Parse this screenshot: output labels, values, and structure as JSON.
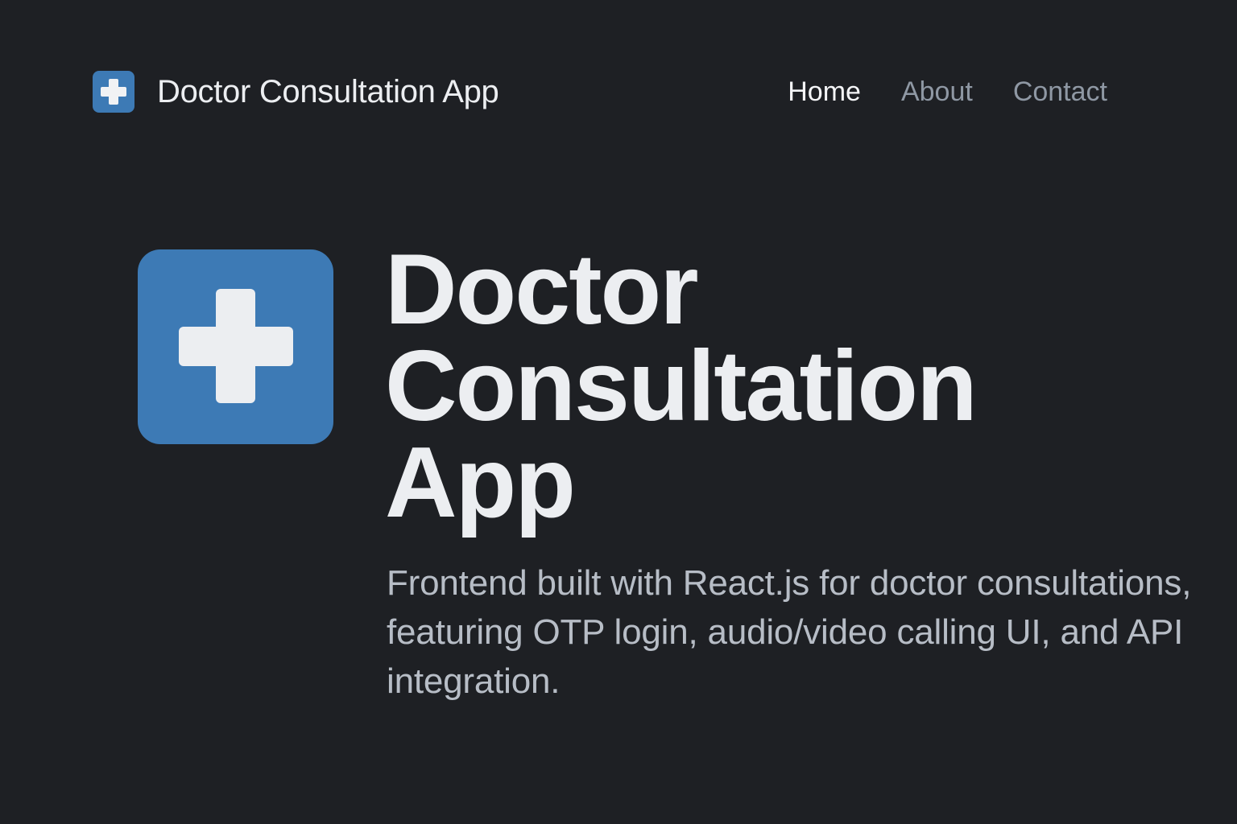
{
  "header": {
    "brand_title": "Doctor Consultation App",
    "brand_icon": "medical-cross-icon",
    "nav": [
      {
        "label": "Home",
        "active": true
      },
      {
        "label": "About",
        "active": false
      },
      {
        "label": "Contact",
        "active": false
      }
    ]
  },
  "hero": {
    "icon": "medical-cross-icon",
    "title_lines": [
      "Doctor",
      "Consultation",
      "App"
    ],
    "description": "Frontend built with React.js for doctor consultations, featuring OTP login, audio/video calling UI, and API integration."
  },
  "colors": {
    "background": "#1e2024",
    "accent": "#3d7ab5",
    "text_primary": "#eceef1",
    "text_muted": "#8f98a4"
  }
}
